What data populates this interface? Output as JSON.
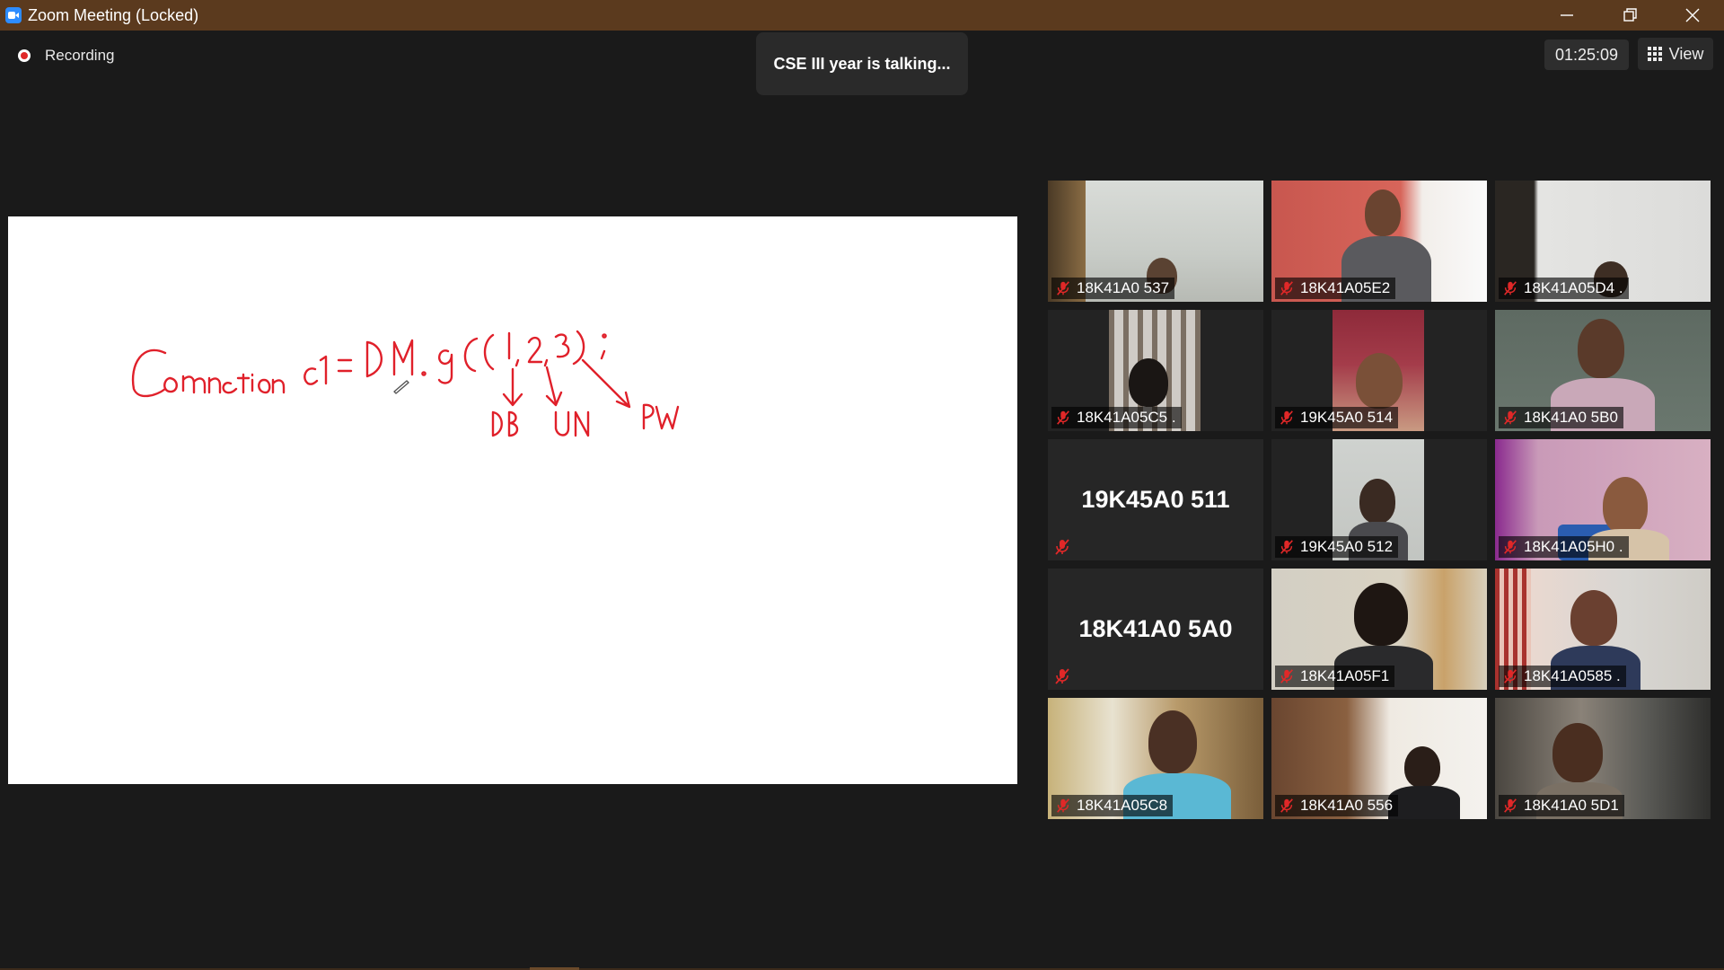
{
  "window": {
    "title": "Zoom Meeting (Locked)",
    "controls": [
      "minimize",
      "restore",
      "close"
    ]
  },
  "meeting": {
    "recording_label": "Recording",
    "speaker_banner": "CSE III year is talking...",
    "timer": "01:25:09",
    "view_label": "View"
  },
  "whiteboard": {
    "handwriting": "Connection c1 = DM.gC(1,2,3); DB UN PW",
    "ink_color": "#e0202a"
  },
  "participants": [
    {
      "name": "18K41A0 537",
      "video": true,
      "muted": true
    },
    {
      "name": "18K41A05E2",
      "video": true,
      "muted": true
    },
    {
      "name": "18K41A05D4 .",
      "video": true,
      "muted": true
    },
    {
      "name": "18K41A05C5 .",
      "video": true,
      "muted": true
    },
    {
      "name": "19K45A0 514",
      "video": true,
      "muted": true
    },
    {
      "name": "18K41A0 5B0",
      "video": true,
      "muted": true
    },
    {
      "name": "19K45A0 511",
      "video": false,
      "muted": true
    },
    {
      "name": "19K45A0 512",
      "video": true,
      "muted": true
    },
    {
      "name": "18K41A05H0 .",
      "video": true,
      "muted": true
    },
    {
      "name": "18K41A0 5A0",
      "video": false,
      "muted": true
    },
    {
      "name": "18K41A05F1",
      "video": true,
      "muted": true
    },
    {
      "name": "18K41A0585 .",
      "video": true,
      "muted": true
    },
    {
      "name": "18K41A05C8",
      "video": true,
      "muted": true
    },
    {
      "name": "18K41A0 556",
      "video": true,
      "muted": true
    },
    {
      "name": "18K41A0 5D1",
      "video": true,
      "muted": true
    }
  ],
  "colors": {
    "title_bar": "#5b3a1e",
    "background": "#1a1a1a",
    "muted_icon": "#e02828",
    "app_accent": "#2d8cff"
  }
}
